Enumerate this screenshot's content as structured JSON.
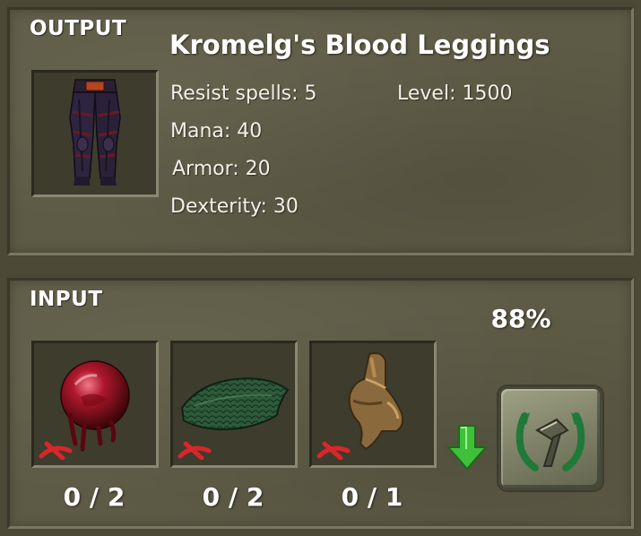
{
  "output": {
    "label": "OUTPUT",
    "item": {
      "name": "Kromelg's Blood Leggings",
      "icon": "leggings-icon",
      "stats": {
        "resist_spells": "Resist spells: 5",
        "level": "Level: 1500",
        "mana": "Mana: 40",
        "armor": "Armor: 20",
        "dexterity": "Dexterity: 30"
      }
    }
  },
  "input": {
    "label": "INPUT",
    "success_chance": "88%",
    "ingredients": [
      {
        "icon": "blood-orb-icon",
        "count": "0 / 2",
        "missing": true
      },
      {
        "icon": "green-hide-icon",
        "count": "0 / 2",
        "missing": true
      },
      {
        "icon": "leather-boot-icon",
        "count": "0 / 1",
        "missing": true
      }
    ],
    "arrow_icon": "down-arrow-icon",
    "craft_button_icon": "hammer-icon"
  },
  "colors": {
    "missing_mark": "#d8262a",
    "arrow": "#3fbf3a",
    "button_ring": "#1f7a3a",
    "panel": "#5d5b45"
  }
}
